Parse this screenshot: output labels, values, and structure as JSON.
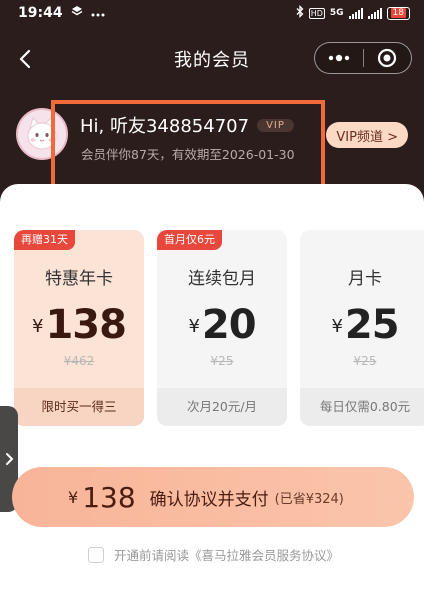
{
  "status_bar": {
    "time": "19:44",
    "network_label": "5G",
    "volte_label": "HD",
    "battery": "18"
  },
  "nav": {
    "title": "我的会员"
  },
  "user": {
    "greeting": "Hi, 听友348854707",
    "vip_tag": "VIP",
    "subtitle": "会员伴你87天，有效期至2026-01-30",
    "vip_channel_label": "VIP频道 >"
  },
  "plans": [
    {
      "badge": "再赠31天",
      "name": "特惠年卡",
      "currency": "¥",
      "price": "138",
      "original": "¥462",
      "footer": "限时买一得三",
      "selected": true
    },
    {
      "badge": "首月仅6元",
      "name": "连续包月",
      "currency": "¥",
      "price": "20",
      "original": "¥25",
      "footer": "次月20元/月",
      "selected": false
    },
    {
      "badge": "",
      "name": "月卡",
      "currency": "¥",
      "price": "25",
      "original": "¥25",
      "footer": "每日仅需0.80元",
      "selected": false
    }
  ],
  "pay": {
    "currency": "¥",
    "amount": "138",
    "label": "确认协议并支付",
    "saved": "(已省¥324)"
  },
  "agreement": {
    "text": "开通前请阅读《喜马拉雅会员服务协议》",
    "checked": false
  },
  "colors": {
    "header_bg": "#2a1d1b",
    "accent_red": "#e8473c",
    "highlight_orange": "#f06a3a",
    "pay_button": "#f8b498"
  },
  "icons": {
    "nav_back": "chevron-left-icon",
    "capsule_more": "more-dots-icon",
    "capsule_close": "target-close-icon",
    "side_handle": "chevron-right-icon"
  }
}
